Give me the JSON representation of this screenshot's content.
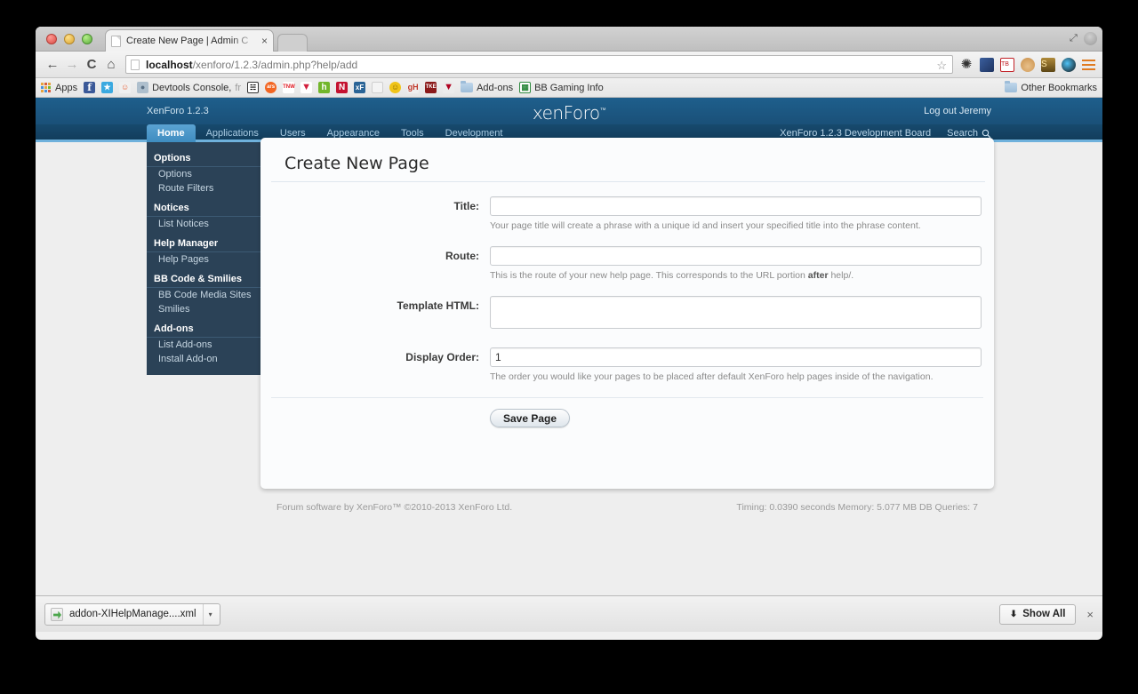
{
  "browser": {
    "tab": {
      "title": "Create New Page | Admin C",
      "close_label": "×",
      "favicon": "page-icon"
    },
    "nav": {
      "back": "←",
      "forward": "→",
      "reload": "C",
      "home": "⌂",
      "url_host": "localhost",
      "url_path": "/xenforo/1.2.3/admin.php?help/add",
      "star": "☆"
    },
    "toolbar_icons": [
      {
        "name": "gear-icon",
        "glyph": "✿",
        "color": "#3a3a3a"
      },
      {
        "name": "extension-pa-icon",
        "glyph": "",
        "color": "#2b4a86"
      },
      {
        "name": "extension-tb-icon",
        "glyph": "",
        "color": "#c22026"
      },
      {
        "name": "extension-santa-icon",
        "glyph": "",
        "color": "#d8a23a"
      },
      {
        "name": "extension-s-icon",
        "glyph": "",
        "color": "#8a6a2a"
      },
      {
        "name": "extension-color-icon",
        "glyph": "",
        "color": "#1c1c1c"
      }
    ],
    "bookmarks": [
      {
        "name": "apps",
        "label": "Apps",
        "icon": "apps-grid-icon",
        "color": "#e8a33d"
      },
      {
        "name": "facebook",
        "label": "",
        "icon": "facebook-icon",
        "color": "#3b5998"
      },
      {
        "name": "twitter",
        "label": "",
        "icon": "twitter-icon",
        "color": "#3aa9e0"
      },
      {
        "name": "reddit",
        "label": "",
        "icon": "reddit-icon",
        "color": "#e8e8e8"
      },
      {
        "name": "devtools-console",
        "label": "Devtools Console,",
        "label_dim": "fr",
        "icon": "user-icon",
        "color": "#9fb4c6"
      },
      {
        "name": "bookmark-spider",
        "label": "",
        "icon": "spider-icon",
        "color": "#ffffff"
      },
      {
        "name": "bookmark-ars",
        "label": "",
        "icon": "ars-icon",
        "color": "#f26522"
      },
      {
        "name": "bookmark-tnw",
        "label": "",
        "icon": "tnw-icon",
        "color": "#ffffff"
      },
      {
        "name": "bookmark-v",
        "label": "",
        "icon": "v-icon",
        "color": "#ffffff"
      },
      {
        "name": "bookmark-h",
        "label": "",
        "icon": "h-icon",
        "color": "#72b62b"
      },
      {
        "name": "bookmark-n",
        "label": "",
        "icon": "n-icon",
        "color": "#c41230"
      },
      {
        "name": "bookmark-xf",
        "label": "",
        "icon": "xf-icon",
        "color": "#2a6496"
      },
      {
        "name": "bookmark-blank",
        "label": "",
        "icon": "page-icon",
        "color": "#f0f0f0"
      },
      {
        "name": "bookmark-smiley",
        "label": "",
        "icon": "smiley-icon",
        "color": "#f0c419"
      },
      {
        "name": "bookmark-gh",
        "label": "",
        "icon": "gh-icon",
        "color": "#e8e8e8"
      },
      {
        "name": "bookmark-tke",
        "label": "",
        "icon": "tke-icon",
        "color": "#8b1a1a"
      },
      {
        "name": "bookmark-v2",
        "label": "",
        "icon": "v-icon",
        "color": "#e8e8e8"
      }
    ],
    "bookmark_folders": [
      {
        "name": "add-ons",
        "label": "Add-ons"
      },
      {
        "name": "bb-gaming-info",
        "label": "BB Gaming Info",
        "icon": "spreadsheet-icon"
      }
    ],
    "other_bookmarks": "Other Bookmarks"
  },
  "xenforo": {
    "version_label": "XenForo 1.2.3",
    "logo": "xenForo",
    "logo_tm": "™",
    "logout": "Log out Jeremy",
    "tabs": [
      {
        "label": "Home",
        "active": true
      },
      {
        "label": "Applications",
        "active": false
      },
      {
        "label": "Users",
        "active": false
      },
      {
        "label": "Appearance",
        "active": false
      },
      {
        "label": "Tools",
        "active": false
      },
      {
        "label": "Development",
        "active": false
      }
    ],
    "nav_right": {
      "board_link": "XenForo 1.2.3 Development Board",
      "search_label": "Search",
      "search_icon": "search-icon"
    },
    "sidebar": [
      {
        "title": "Options",
        "links": [
          "Options",
          "Route Filters"
        ]
      },
      {
        "title": "Notices",
        "links": [
          "List Notices"
        ]
      },
      {
        "title": "Help Manager",
        "links": [
          "Help Pages"
        ]
      },
      {
        "title": "BB Code & Smilies",
        "links": [
          "BB Code Media Sites",
          "Smilies"
        ]
      },
      {
        "title": "Add-ons",
        "links": [
          "List Add-ons",
          "Install Add-on"
        ]
      }
    ],
    "content": {
      "title": "Create New Page",
      "fields": [
        {
          "label": "Title:",
          "type": "text",
          "value": "",
          "hint": "Your page title will create a phrase with a unique id and insert your specified title into the phrase content.",
          "hint_bold": "",
          "hint_tail": ""
        },
        {
          "label": "Route:",
          "type": "text",
          "value": "",
          "hint": "This is the route of your new help page. This corresponds to the URL portion ",
          "hint_bold": "after",
          "hint_tail": " help/."
        },
        {
          "label": "Template HTML:",
          "type": "textarea",
          "value": "",
          "hint": "",
          "hint_bold": "",
          "hint_tail": ""
        },
        {
          "label": "Display Order:",
          "type": "text",
          "value": "1",
          "hint": "The order you would like your pages to be placed after default XenForo help pages inside of the navigation.",
          "hint_bold": "",
          "hint_tail": ""
        }
      ],
      "save_button": "Save Page"
    },
    "footer": {
      "copyright": "Forum software by XenForo™ ©2010-2013 XenForo Ltd.",
      "stats": "Timing: 0.0390 seconds Memory: 5.077 MB DB Queries: 7"
    }
  },
  "downloads": {
    "filename": "addon-XIHelpManage....xml",
    "menu_arrow": "▾",
    "show_all": "Show All",
    "show_all_icon": "⬇",
    "close": "×"
  },
  "colors": {
    "xf_header_blue": "#1e5f8c",
    "xf_nav_dark": "#174a6e",
    "xf_accent_light": "#6fb1dc",
    "xf_sidebar": "#2b4257",
    "xf_tab_active": "#5ba3d2",
    "page_bg": "#eeeeee"
  }
}
